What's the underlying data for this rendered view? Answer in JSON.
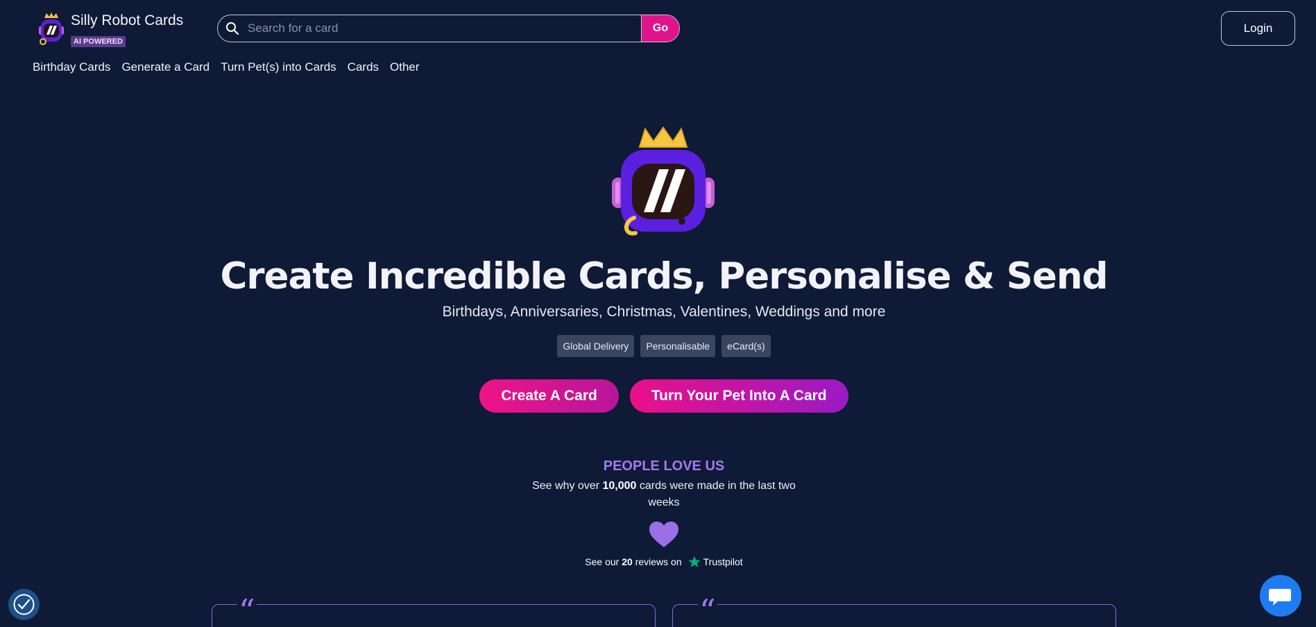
{
  "brand": {
    "name": "Silly Robot Cards",
    "badge": "AI POWERED",
    "logo_icon": "robot-crown-logo"
  },
  "search": {
    "placeholder": "Search for a card",
    "value": "",
    "button_label": "Go"
  },
  "header": {
    "login_label": "Login"
  },
  "nav": {
    "items": [
      {
        "label": "Birthday Cards"
      },
      {
        "label": "Generate a Card"
      },
      {
        "label": "Turn Pet(s) into Cards"
      },
      {
        "label": "Cards"
      },
      {
        "label": "Other"
      }
    ]
  },
  "hero": {
    "title": "Create Incredible Cards, Personalise & Send",
    "subtitle": "Birthdays, Anniversaries, Christmas, Valentines, Weddings and more",
    "tags": [
      "Global Delivery",
      "Personalisable",
      "eCard(s)"
    ],
    "cta_primary": "Create A Card",
    "cta_secondary": "Turn Your Pet Into A Card"
  },
  "social": {
    "heading": "PEOPLE LOVE US",
    "text_before": "See why over ",
    "count": "10,000",
    "text_after": " cards were made in the last two weeks",
    "trust_before": "See our ",
    "review_count": "20",
    "trust_after": " reviews on",
    "trust_brand": "Trustpilot"
  },
  "reviews": [
    {
      "quote_mark": "“"
    },
    {
      "quote_mark": "“"
    }
  ],
  "colors": {
    "background": "#0f1a36",
    "accent_pink": "#e0148a",
    "accent_purple": "#a479f0",
    "chat_blue": "#1f7cf0"
  },
  "icons": {
    "accessibility": "accessibility-icon",
    "chat": "chat-icon",
    "heart": "heart-icon",
    "trustpilot": "trustpilot-star-icon"
  }
}
